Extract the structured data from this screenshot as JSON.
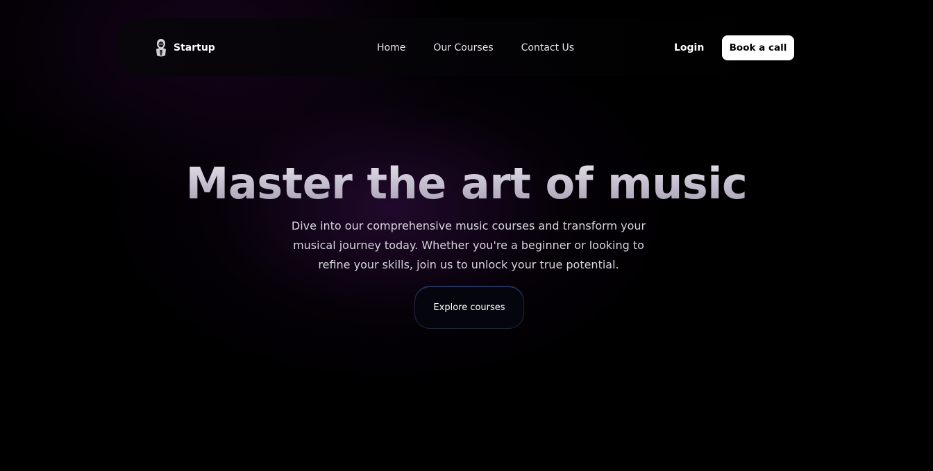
{
  "brand": {
    "name": "Startup",
    "logo_icon": "hooded-figure-logo-icon"
  },
  "nav": {
    "links": [
      {
        "label": "Home"
      },
      {
        "label": "Our Courses"
      },
      {
        "label": "Contact Us"
      }
    ],
    "login_label": "Login",
    "cta_label": "Book a call"
  },
  "hero": {
    "title": "Master the art of music",
    "subtitle": "Dive into our comprehensive music courses and transform your musical journey today. Whether you're a beginner or looking to refine your skills, join us to unlock your true potential.",
    "button_label": "Explore courses"
  },
  "colors": {
    "background": "#000000",
    "glow": "#3c1050",
    "button_accent": "#466edc"
  }
}
